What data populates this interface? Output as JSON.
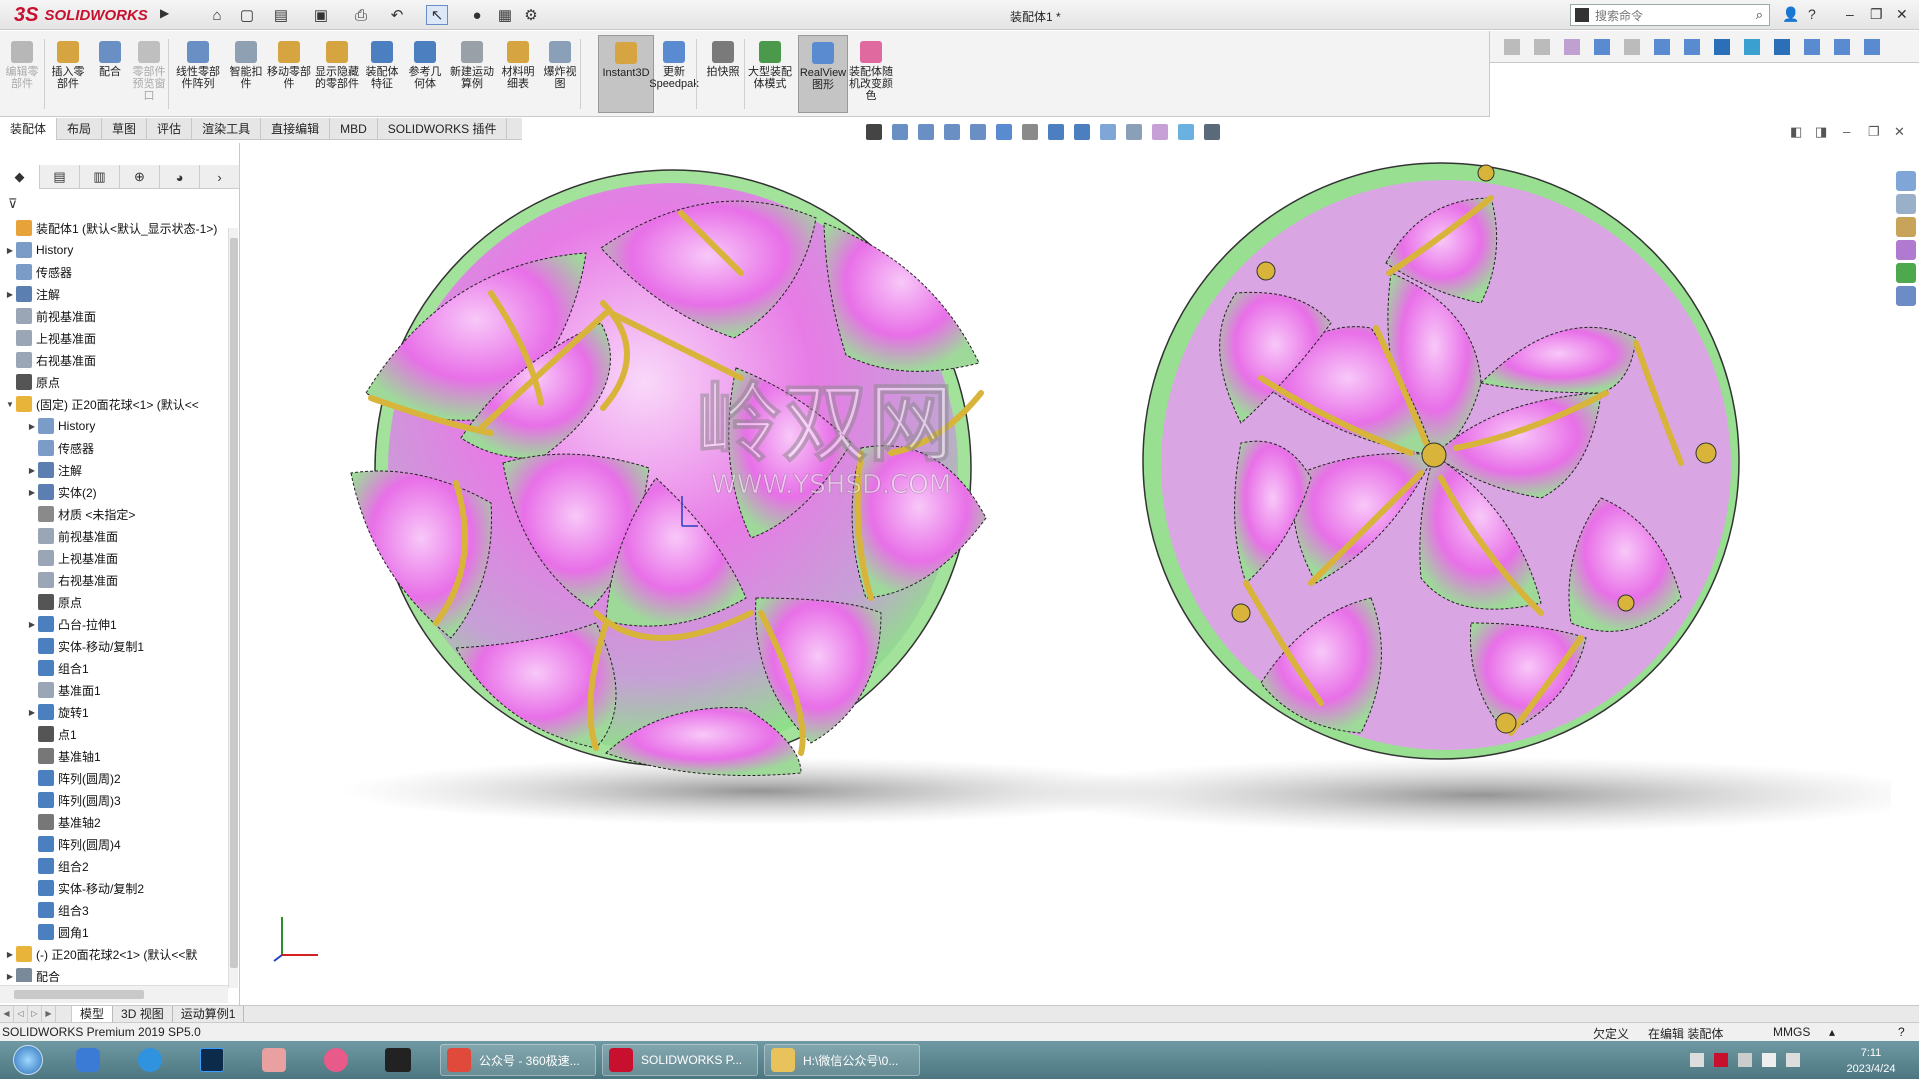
{
  "app": {
    "logo_text": "SOLIDWORKS",
    "logo_mark": "3S",
    "doc_title": "装配体1 *",
    "search_placeholder": "搜索命令"
  },
  "ribbon": {
    "buttons": [
      {
        "label": "编辑零部件",
        "disabled": true
      },
      {
        "label": "插入零部件"
      },
      {
        "label": "配合"
      },
      {
        "label": "零部件预览窗口",
        "disabled": true
      },
      {
        "label": "线性零部件阵列"
      },
      {
        "label": "智能扣件"
      },
      {
        "label": "移动零部件"
      },
      {
        "label": "显示隐藏的零部件"
      },
      {
        "label": "装配体特征"
      },
      {
        "label": "参考几何体"
      },
      {
        "label": "新建运动算例"
      },
      {
        "label": "材料明细表"
      },
      {
        "label": "爆炸视图"
      },
      {
        "label": "Instant3D",
        "active": true
      },
      {
        "label": "更新Speedpak"
      },
      {
        "label": "拍快照"
      },
      {
        "label": "大型装配体模式"
      },
      {
        "label": "RealView图形",
        "active": true
      },
      {
        "label": "装配体随机改变颜色"
      }
    ]
  },
  "tabs": [
    "装配体",
    "布局",
    "草图",
    "评估",
    "渲染工具",
    "直接编辑",
    "MBD",
    "SOLIDWORKS 插件"
  ],
  "tree": [
    {
      "level": 0,
      "arrow": "",
      "label": "装配体1 (默认<默认_显示状态-1>)",
      "icon": "assembly-icon",
      "color": "#e8a23a"
    },
    {
      "level": 0,
      "arrow": "▶",
      "label": "History",
      "icon": "history-icon",
      "color": "#7a9cc6"
    },
    {
      "level": 0,
      "arrow": "",
      "label": "传感器",
      "icon": "sensor-icon",
      "color": "#7a9cc6"
    },
    {
      "level": 0,
      "arrow": "▶",
      "label": "注解",
      "icon": "annotation-icon",
      "color": "#5b7fb0"
    },
    {
      "level": 0,
      "arrow": "",
      "label": "前视基准面",
      "icon": "plane-icon",
      "color": "#9aa6b5"
    },
    {
      "level": 0,
      "arrow": "",
      "label": "上视基准面",
      "icon": "plane-icon",
      "color": "#9aa6b5"
    },
    {
      "level": 0,
      "arrow": "",
      "label": "右视基准面",
      "icon": "plane-icon",
      "color": "#9aa6b5"
    },
    {
      "level": 0,
      "arrow": "",
      "label": "原点",
      "icon": "origin-icon",
      "color": "#555"
    },
    {
      "level": 0,
      "arrow": "▼",
      "label": "(固定) 正20面花球<1> (默认<<",
      "icon": "part-icon",
      "color": "#e8b43a"
    },
    {
      "level": 1,
      "arrow": "▶",
      "label": "History",
      "icon": "history-icon",
      "color": "#7a9cc6"
    },
    {
      "level": 1,
      "arrow": "",
      "label": "传感器",
      "icon": "sensor-icon",
      "color": "#7a9cc6"
    },
    {
      "level": 1,
      "arrow": "▶",
      "label": "注解",
      "icon": "annotation-icon",
      "color": "#5b7fb0"
    },
    {
      "level": 1,
      "arrow": "▶",
      "label": "实体(2)",
      "icon": "solid-body-icon",
      "color": "#5b7fb0"
    },
    {
      "level": 1,
      "arrow": "",
      "label": "材质 <未指定>",
      "icon": "material-icon",
      "color": "#8a8a8a"
    },
    {
      "level": 1,
      "arrow": "",
      "label": "前视基准面",
      "icon": "plane-icon",
      "color": "#9aa6b5"
    },
    {
      "level": 1,
      "arrow": "",
      "label": "上视基准面",
      "icon": "plane-icon",
      "color": "#9aa6b5"
    },
    {
      "level": 1,
      "arrow": "",
      "label": "右视基准面",
      "icon": "plane-icon",
      "color": "#9aa6b5"
    },
    {
      "level": 1,
      "arrow": "",
      "label": "原点",
      "icon": "origin-icon",
      "color": "#555"
    },
    {
      "level": 1,
      "arrow": "▶",
      "label": "凸台-拉伸1",
      "icon": "extrude-icon",
      "color": "#4b7fc0"
    },
    {
      "level": 1,
      "arrow": "",
      "label": "实体-移动/复制1",
      "icon": "move-copy-icon",
      "color": "#4b7fc0"
    },
    {
      "level": 1,
      "arrow": "",
      "label": "组合1",
      "icon": "combine-icon",
      "color": "#4b7fc0"
    },
    {
      "level": 1,
      "arrow": "",
      "label": "基准面1",
      "icon": "plane-icon",
      "color": "#9aa6b5"
    },
    {
      "level": 1,
      "arrow": "▶",
      "label": "旋转1",
      "icon": "revolve-icon",
      "color": "#4b7fc0"
    },
    {
      "level": 1,
      "arrow": "",
      "label": "点1",
      "icon": "point-icon",
      "color": "#555"
    },
    {
      "level": 1,
      "arrow": "",
      "label": "基准轴1",
      "icon": "axis-icon",
      "color": "#777"
    },
    {
      "level": 1,
      "arrow": "",
      "label": "阵列(圆周)2",
      "icon": "circular-pattern-icon",
      "color": "#4b7fc0"
    },
    {
      "level": 1,
      "arrow": "",
      "label": "阵列(圆周)3",
      "icon": "circular-pattern-icon",
      "color": "#4b7fc0"
    },
    {
      "level": 1,
      "arrow": "",
      "label": "基准轴2",
      "icon": "axis-icon",
      "color": "#777"
    },
    {
      "level": 1,
      "arrow": "",
      "label": "阵列(圆周)4",
      "icon": "circular-pattern-icon",
      "color": "#4b7fc0"
    },
    {
      "level": 1,
      "arrow": "",
      "label": "组合2",
      "icon": "combine-icon",
      "color": "#4b7fc0"
    },
    {
      "level": 1,
      "arrow": "",
      "label": "实体-移动/复制2",
      "icon": "move-copy-icon",
      "color": "#4b7fc0"
    },
    {
      "level": 1,
      "arrow": "",
      "label": "组合3",
      "icon": "combine-icon",
      "color": "#4b7fc0"
    },
    {
      "level": 1,
      "arrow": "",
      "label": "圆角1",
      "icon": "fillet-icon",
      "color": "#4b7fc0"
    },
    {
      "level": 0,
      "arrow": "▶",
      "label": "(-) 正20面花球2<1> (默认<<默",
      "icon": "part-icon",
      "color": "#e8b43a"
    },
    {
      "level": 0,
      "arrow": "▶",
      "label": "配合",
      "icon": "mates-icon",
      "color": "#7a8a9a"
    }
  ],
  "bottom_tabs": [
    "模型",
    "3D 视图",
    "运动算例1"
  ],
  "status": {
    "left": "SOLIDWORKS Premium 2019 SP5.0",
    "defined": "欠定义",
    "editing": "在编辑 装配体",
    "units": "MMGS"
  },
  "taskbar": {
    "tasks": [
      {
        "label": "公众号 - 360极速...",
        "icon_color": "#e04a3a"
      },
      {
        "label": "SOLIDWORKS P...",
        "icon_color": "#c8102e"
      },
      {
        "label": "H:\\微信公众号\\0...",
        "icon_color": "#e8c25a"
      }
    ],
    "time": "7:11",
    "date": "2023/4/24"
  },
  "watermark": {
    "text": "WWW.YSHSD.COM",
    "brand": "岭双网"
  },
  "colors": {
    "petal": "#e86fe8",
    "petal_light": "#f4b8f4",
    "base": "#8fe08a",
    "gold": "#d8b43a",
    "brand_red": "#c8102e"
  }
}
